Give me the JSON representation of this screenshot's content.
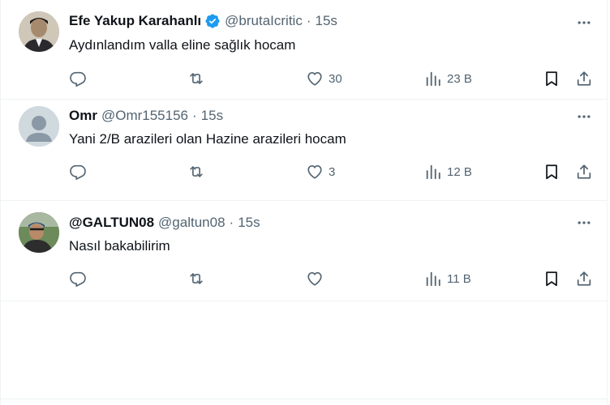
{
  "tweets": [
    {
      "name": "Efe Yakup Karahanlı",
      "verified": true,
      "handle": "@brutaIcritic",
      "time": "15s",
      "text": "Aydınlandım valla eline sağlık hocam",
      "likes": "30",
      "views": "23 B"
    },
    {
      "name": "Omr",
      "verified": false,
      "handle": "@Omr155156",
      "time": "15s",
      "text": "Yani 2/B arazileri olan Hazine arazileri hocam",
      "likes": "3",
      "views": "12 B"
    },
    {
      "name": "@GALTUN08",
      "verified": false,
      "handle": "@galtun08",
      "time": "15s",
      "text": "Nasıl bakabilirim",
      "likes": "",
      "views": "11 B"
    }
  ],
  "separator": "·",
  "icons": {
    "reply": "reply-icon",
    "retweet": "retweet-icon",
    "like": "heart-icon",
    "views": "views-icon",
    "bookmark": "bookmark-icon",
    "share": "share-icon",
    "more": "more-icon",
    "verified": "verified-badge-icon"
  },
  "colors": {
    "text": "#0f1419",
    "muted": "#536471",
    "verified": "#1d9bf0",
    "border": "#eff3f4"
  }
}
